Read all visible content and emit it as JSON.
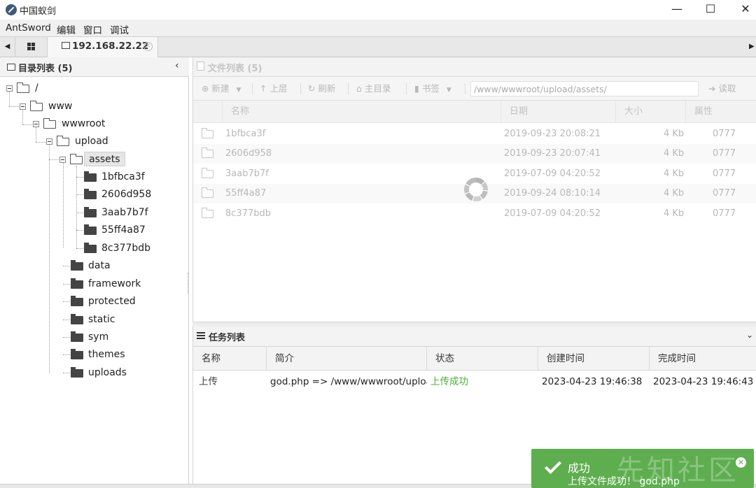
{
  "window": {
    "title": "中国蚁剑"
  },
  "menu": [
    "AntSword",
    "编辑",
    "窗口",
    "调试"
  ],
  "tabs": {
    "active_label": "192.168.22.22"
  },
  "left_panel": {
    "title": "目录列表 (5)",
    "tree": {
      "root": "/",
      "www": "www",
      "wwwroot": "wwwroot",
      "upload": "upload",
      "assets": "assets",
      "assets_children": [
        "1bfbca3f",
        "2606d958",
        "3aab7b7f",
        "55ff4a87",
        "8c377bdb"
      ],
      "upload_siblings": [
        "data",
        "framework",
        "protected",
        "static",
        "sym",
        "themes",
        "uploads"
      ]
    }
  },
  "file_panel": {
    "title": "文件列表 (5)",
    "toolbar": {
      "new": "新建",
      "up": "上层",
      "refresh": "刷新",
      "home": "主目录",
      "bookmark": "书签",
      "read": "读取"
    },
    "path": "/www/wwwroot/upload/assets/",
    "columns": [
      "名称",
      "日期",
      "大小",
      "属性"
    ],
    "rows": [
      {
        "name": "1bfbca3f",
        "date": "2019-09-23 20:08:21",
        "size": "4 Kb",
        "perm": "0777"
      },
      {
        "name": "2606d958",
        "date": "2019-09-23 20:07:41",
        "size": "4 Kb",
        "perm": "0777"
      },
      {
        "name": "3aab7b7f",
        "date": "2019-07-09 04:20:52",
        "size": "4 Kb",
        "perm": "0777"
      },
      {
        "name": "55ff4a87",
        "date": "2019-09-24 08:10:14",
        "size": "4 Kb",
        "perm": "0777"
      },
      {
        "name": "8c377bdb",
        "date": "2019-07-09 04:20:52",
        "size": "4 Kb",
        "perm": "0777"
      }
    ]
  },
  "task_panel": {
    "title": "任务列表",
    "columns": [
      "名称",
      "简介",
      "状态",
      "创建时间",
      "完成时间"
    ],
    "rows": [
      {
        "name": "上传",
        "desc": "god.php => /www/wwwroot/upload/",
        "status": "上传成功",
        "created": "2023-04-23 19:46:38",
        "finished": "2023-04-23 19:46:43"
      }
    ],
    "status_color": "#4caf3a"
  },
  "toast": {
    "title": "成功",
    "message": "上传文件成功！ god.php",
    "color": "#5eae4f"
  },
  "watermark": "先知社区"
}
